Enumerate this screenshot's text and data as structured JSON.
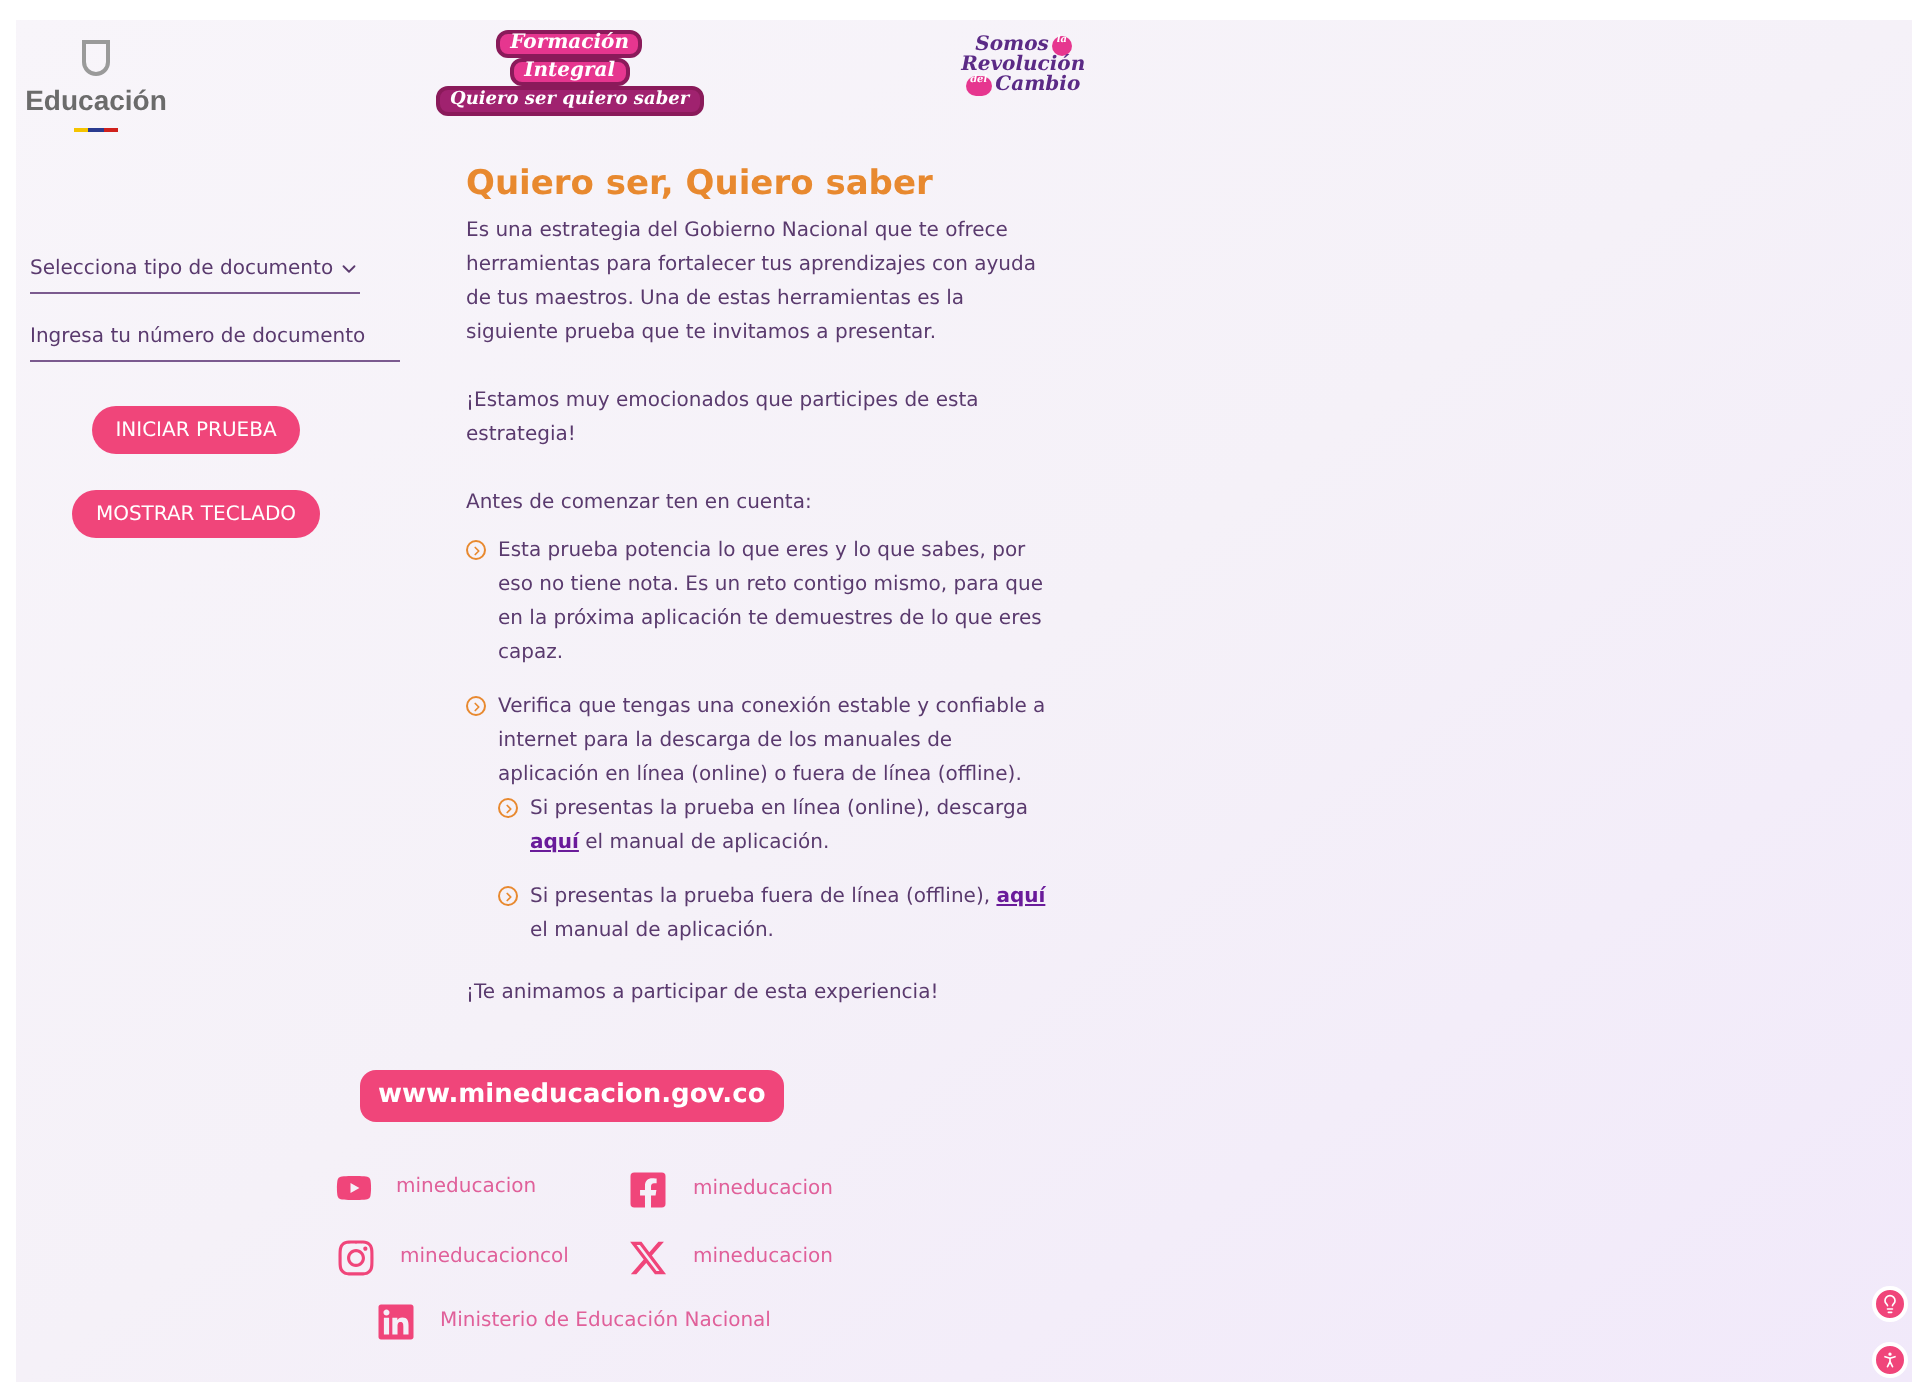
{
  "header": {
    "ministry": "Educación",
    "logo_main": [
      "Formación",
      "Integral",
      "Quiero ser quiero saber"
    ],
    "logo_side": [
      "Somos",
      "la",
      "Revolución",
      "del",
      "Cambio"
    ]
  },
  "form": {
    "document_type": {
      "placeholder": "Selecciona tipo de documento"
    },
    "document_number": {
      "placeholder": "Ingresa tu número de documento"
    },
    "buttons": [
      "INICIAR PRUEBA",
      "MOSTRAR TECLADO"
    ]
  },
  "content": {
    "title": "Quiero ser, Quiero saber",
    "paragraphs": [
      "Es una estrategia del Gobierno Nacional que te ofrece herramientas para fortalecer tus aprendizajes con ayuda de tus maestros. Una de estas herramientas es la siguiente prueba que te invitamos a presentar.",
      "¡Estamos muy emocionados que participes de esta estrategia!",
      "Antes de comenzar ten en cuenta:"
    ],
    "items": [
      {
        "text": "Esta prueba potencia lo que eres y lo que sabes, por eso no tiene nota. Es un reto contigo mismo, para que en la próxima aplicación te demuestres de lo que eres capaz."
      },
      {
        "text": "Verifica que tengas una conexión estable y confiable a internet para la descarga de los manuales de aplicación en línea (online) o fuera de línea (offline).",
        "children": [
          {
            "before": "Si presentas la prueba en línea (online), descarga",
            "link": "aquí",
            "after": "el manual de aplicación."
          },
          {
            "before": "Si presentas la prueba fuera de línea (offline),",
            "link": "aquí",
            "after": "el manual de aplicación."
          }
        ]
      }
    ],
    "closing": "¡Te animamos a participar de esta experiencia!"
  },
  "footer": {
    "website": "www.mineducacion.gov.co",
    "social": [
      {
        "kind": "youtube",
        "handle": "mineducacion"
      },
      {
        "kind": "facebook",
        "handle": "mineducacion"
      },
      {
        "kind": "instagram",
        "handle": "mineducacioncol"
      },
      {
        "kind": "x",
        "handle": "mineducacion"
      },
      {
        "kind": "linkedin",
        "handle": "Ministerio de Educación Nacional"
      }
    ]
  }
}
